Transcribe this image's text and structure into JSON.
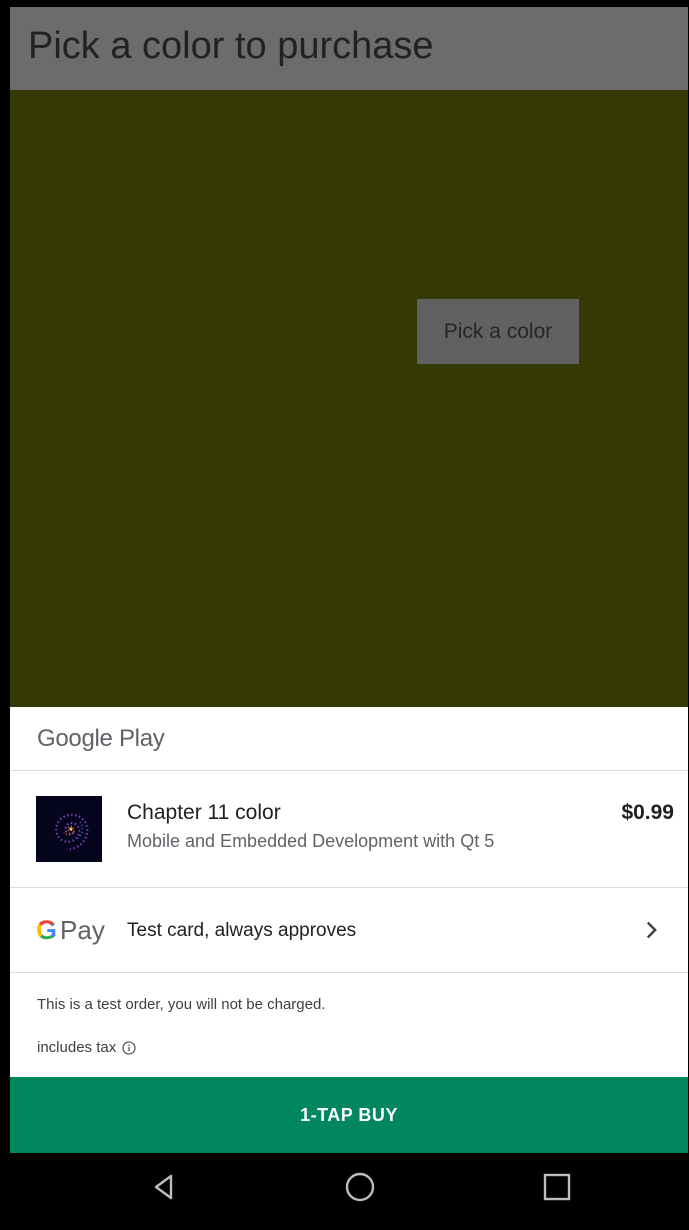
{
  "app": {
    "title": "Pick a color to purchase",
    "pick_button_label": "Pick a color",
    "content_color": "#353903"
  },
  "sheet": {
    "brand": "Google Play",
    "item": {
      "title": "Chapter 11 color",
      "subtitle": "Mobile and Embedded Development with Qt 5",
      "price": "$0.99",
      "thumbnail_icon": "spiral-galaxy-thumbnail"
    },
    "payment": {
      "logo_g": "G",
      "logo_pay": "Pay",
      "method": "Test card, always approves",
      "chevron_icon": "chevron-right-icon"
    },
    "test_notice": "This is a test order, you will not be charged.",
    "tax_note": "includes tax",
    "buy_label": "1-TAP BUY",
    "buy_color": "#01875f"
  },
  "nav": {
    "back_icon": "back-triangle-icon",
    "home_icon": "home-circle-icon",
    "recents_icon": "recents-square-icon"
  }
}
